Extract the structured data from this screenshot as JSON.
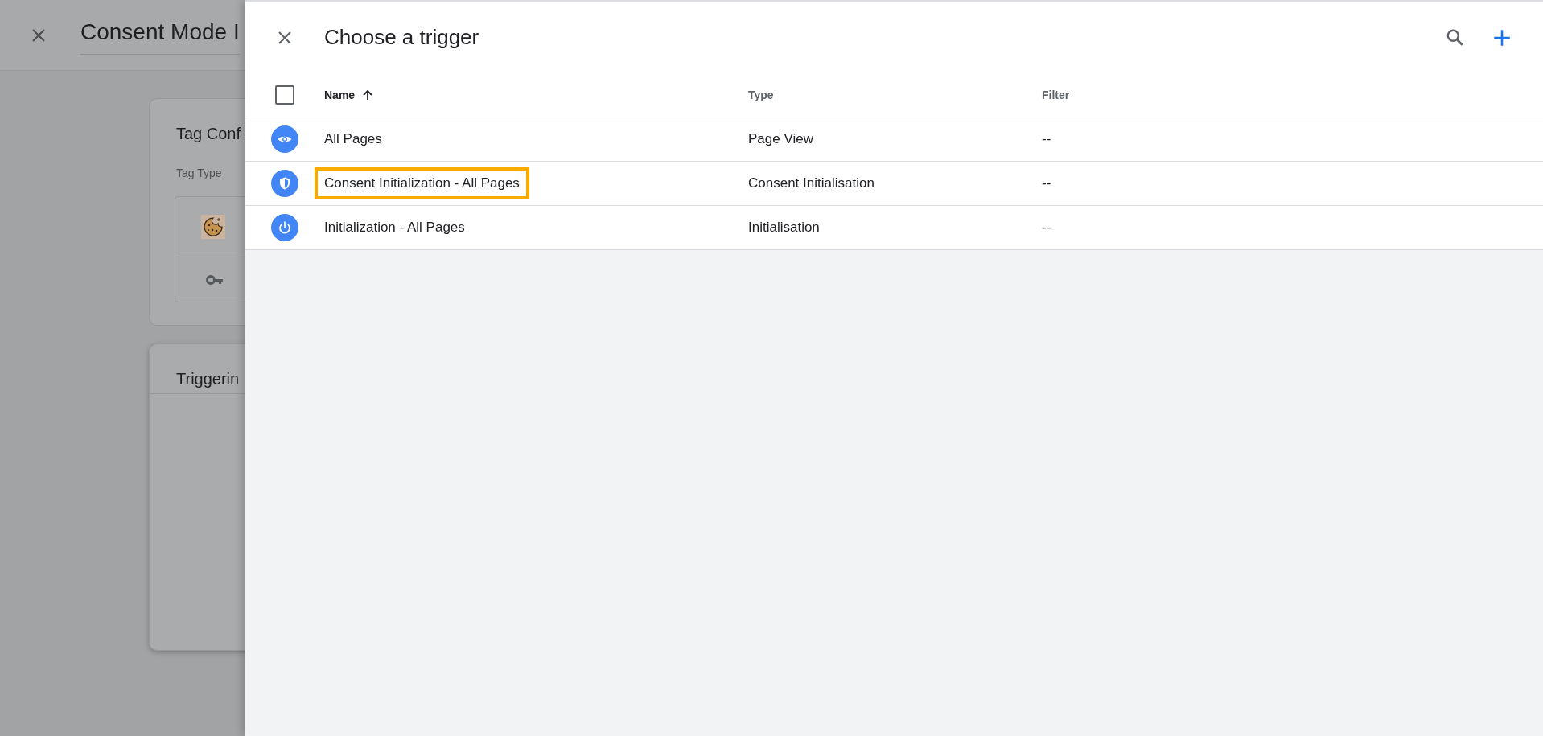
{
  "background_editor": {
    "title": "Consent Mode I",
    "cards": [
      {
        "title": "Tag Conf",
        "field_label": "Tag Type"
      },
      {
        "title": "Triggerin"
      }
    ]
  },
  "panel": {
    "title": "Choose a trigger"
  },
  "table": {
    "columns": [
      {
        "label": "Name",
        "sorted": true
      },
      {
        "label": "Type",
        "sorted": false
      },
      {
        "label": "Filter",
        "sorted": false
      }
    ],
    "select_all_checked": false,
    "rows": [
      {
        "kind": "page_view",
        "name": "All Pages",
        "type": "Page View",
        "filter": "--",
        "highlighted": false
      },
      {
        "kind": "consent",
        "name": "Consent Initialization - All Pages",
        "type": "Consent Initialisation",
        "filter": "--",
        "highlighted": true
      },
      {
        "kind": "init",
        "name": "Initialization - All Pages",
        "type": "Initialisation",
        "filter": "--",
        "highlighted": false
      }
    ]
  }
}
